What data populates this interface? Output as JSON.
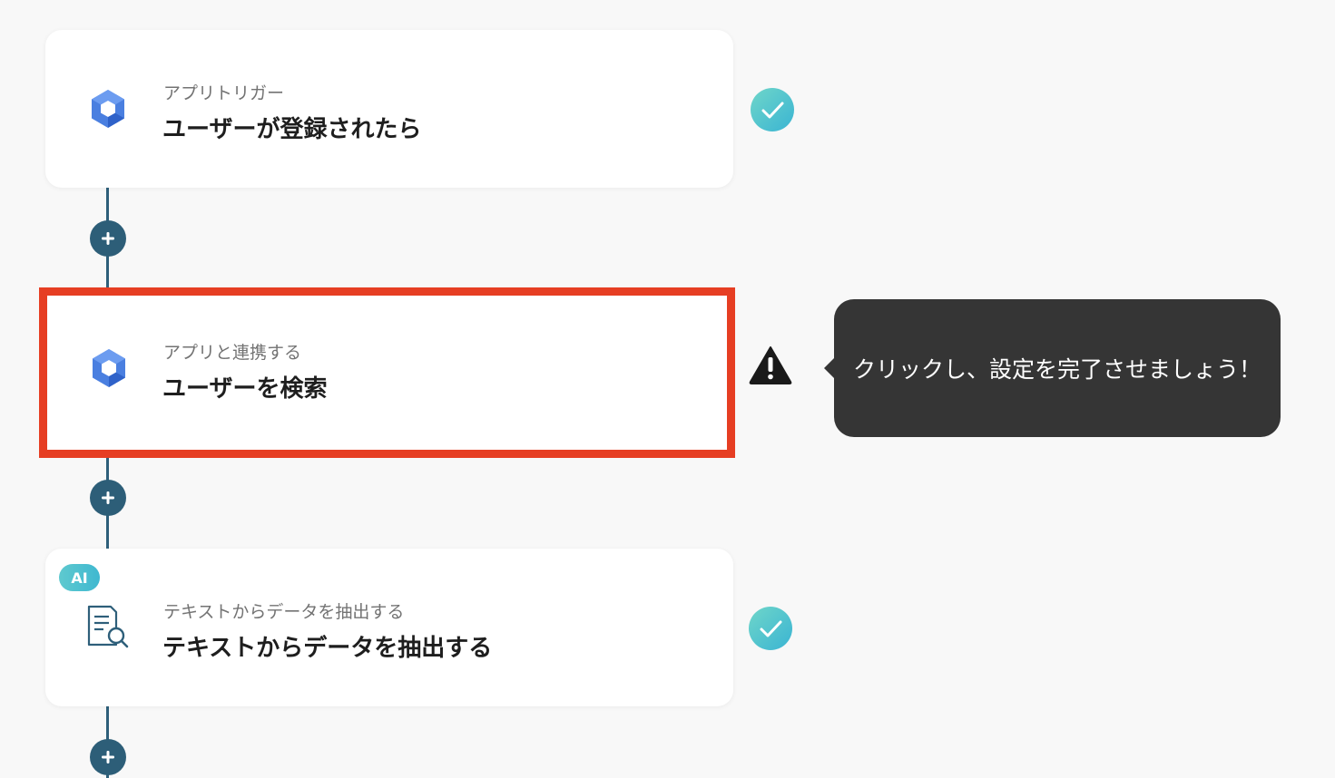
{
  "steps": [
    {
      "subtitle": "アプリトリガー",
      "title": "ユーザーが登録されたら",
      "icon": "google-workspace-icon",
      "status": "complete"
    },
    {
      "subtitle": "アプリと連携する",
      "title": "ユーザーを検索",
      "icon": "google-workspace-icon",
      "status": "warning"
    },
    {
      "subtitle": "テキストからデータを抽出する",
      "title": "テキストからデータを抽出する",
      "icon": "document-search-icon",
      "status": "complete",
      "badge": "AI"
    }
  ],
  "tooltip": {
    "text": "クリックし、設定を完了させましょう！"
  },
  "colors": {
    "background": "#f8f8f8",
    "connector": "#2e5f7a",
    "highlight_border": "#e63e23",
    "check_gradient_start": "#5ec9cf",
    "check_gradient_end": "#3fb8d0",
    "tooltip_bg": "#353535",
    "google_blue": "#4a7fe0"
  },
  "icons": {
    "add": "plus-icon",
    "complete": "check-circle-icon",
    "warning": "warning-triangle-icon"
  }
}
